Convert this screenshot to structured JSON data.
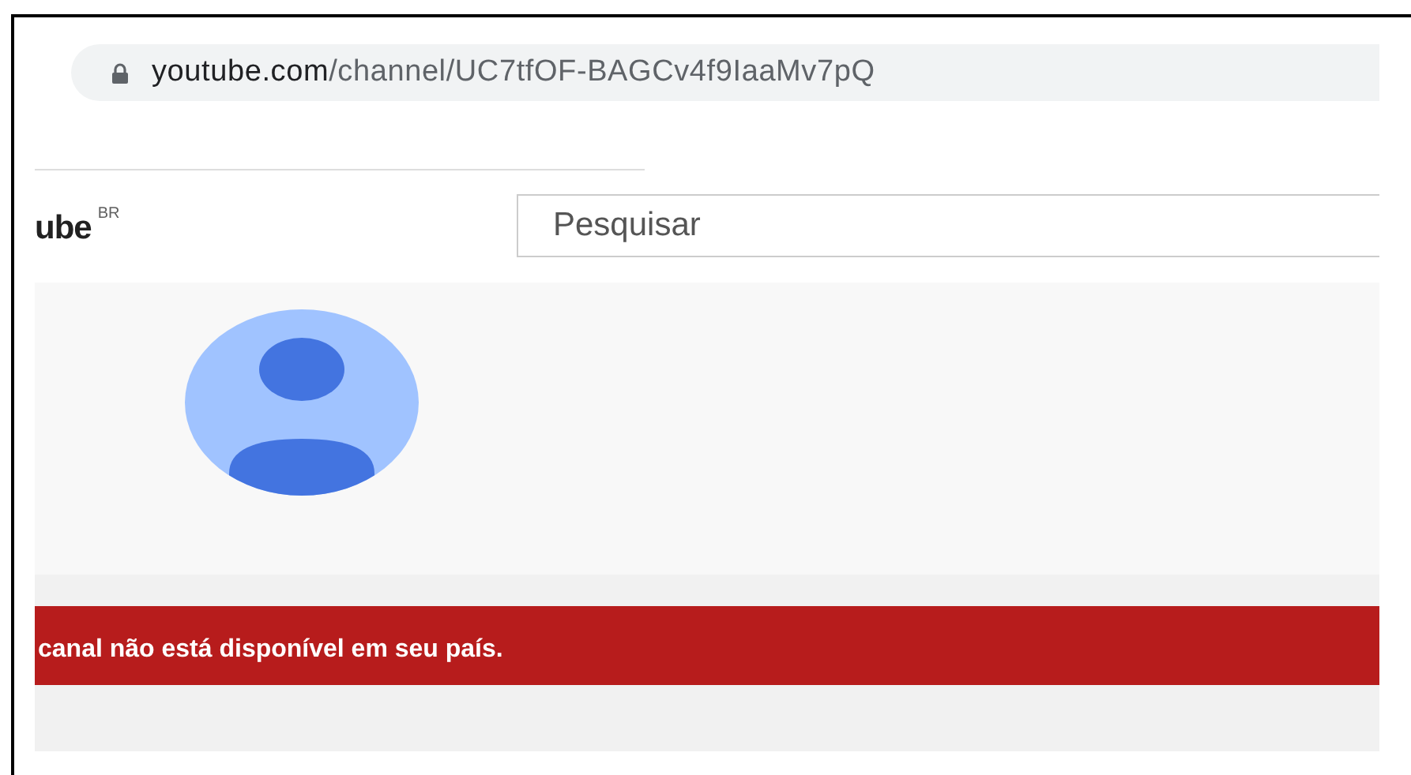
{
  "address_bar": {
    "domain": "youtube.com",
    "path": "/channel/UC7tfOF-BAGCv4f9IaaMv7pQ"
  },
  "header": {
    "logo_text": "ube",
    "region": "BR",
    "search": {
      "placeholder": "Pesquisar"
    }
  },
  "alert": {
    "message": "canal não está disponível em seu país."
  }
}
